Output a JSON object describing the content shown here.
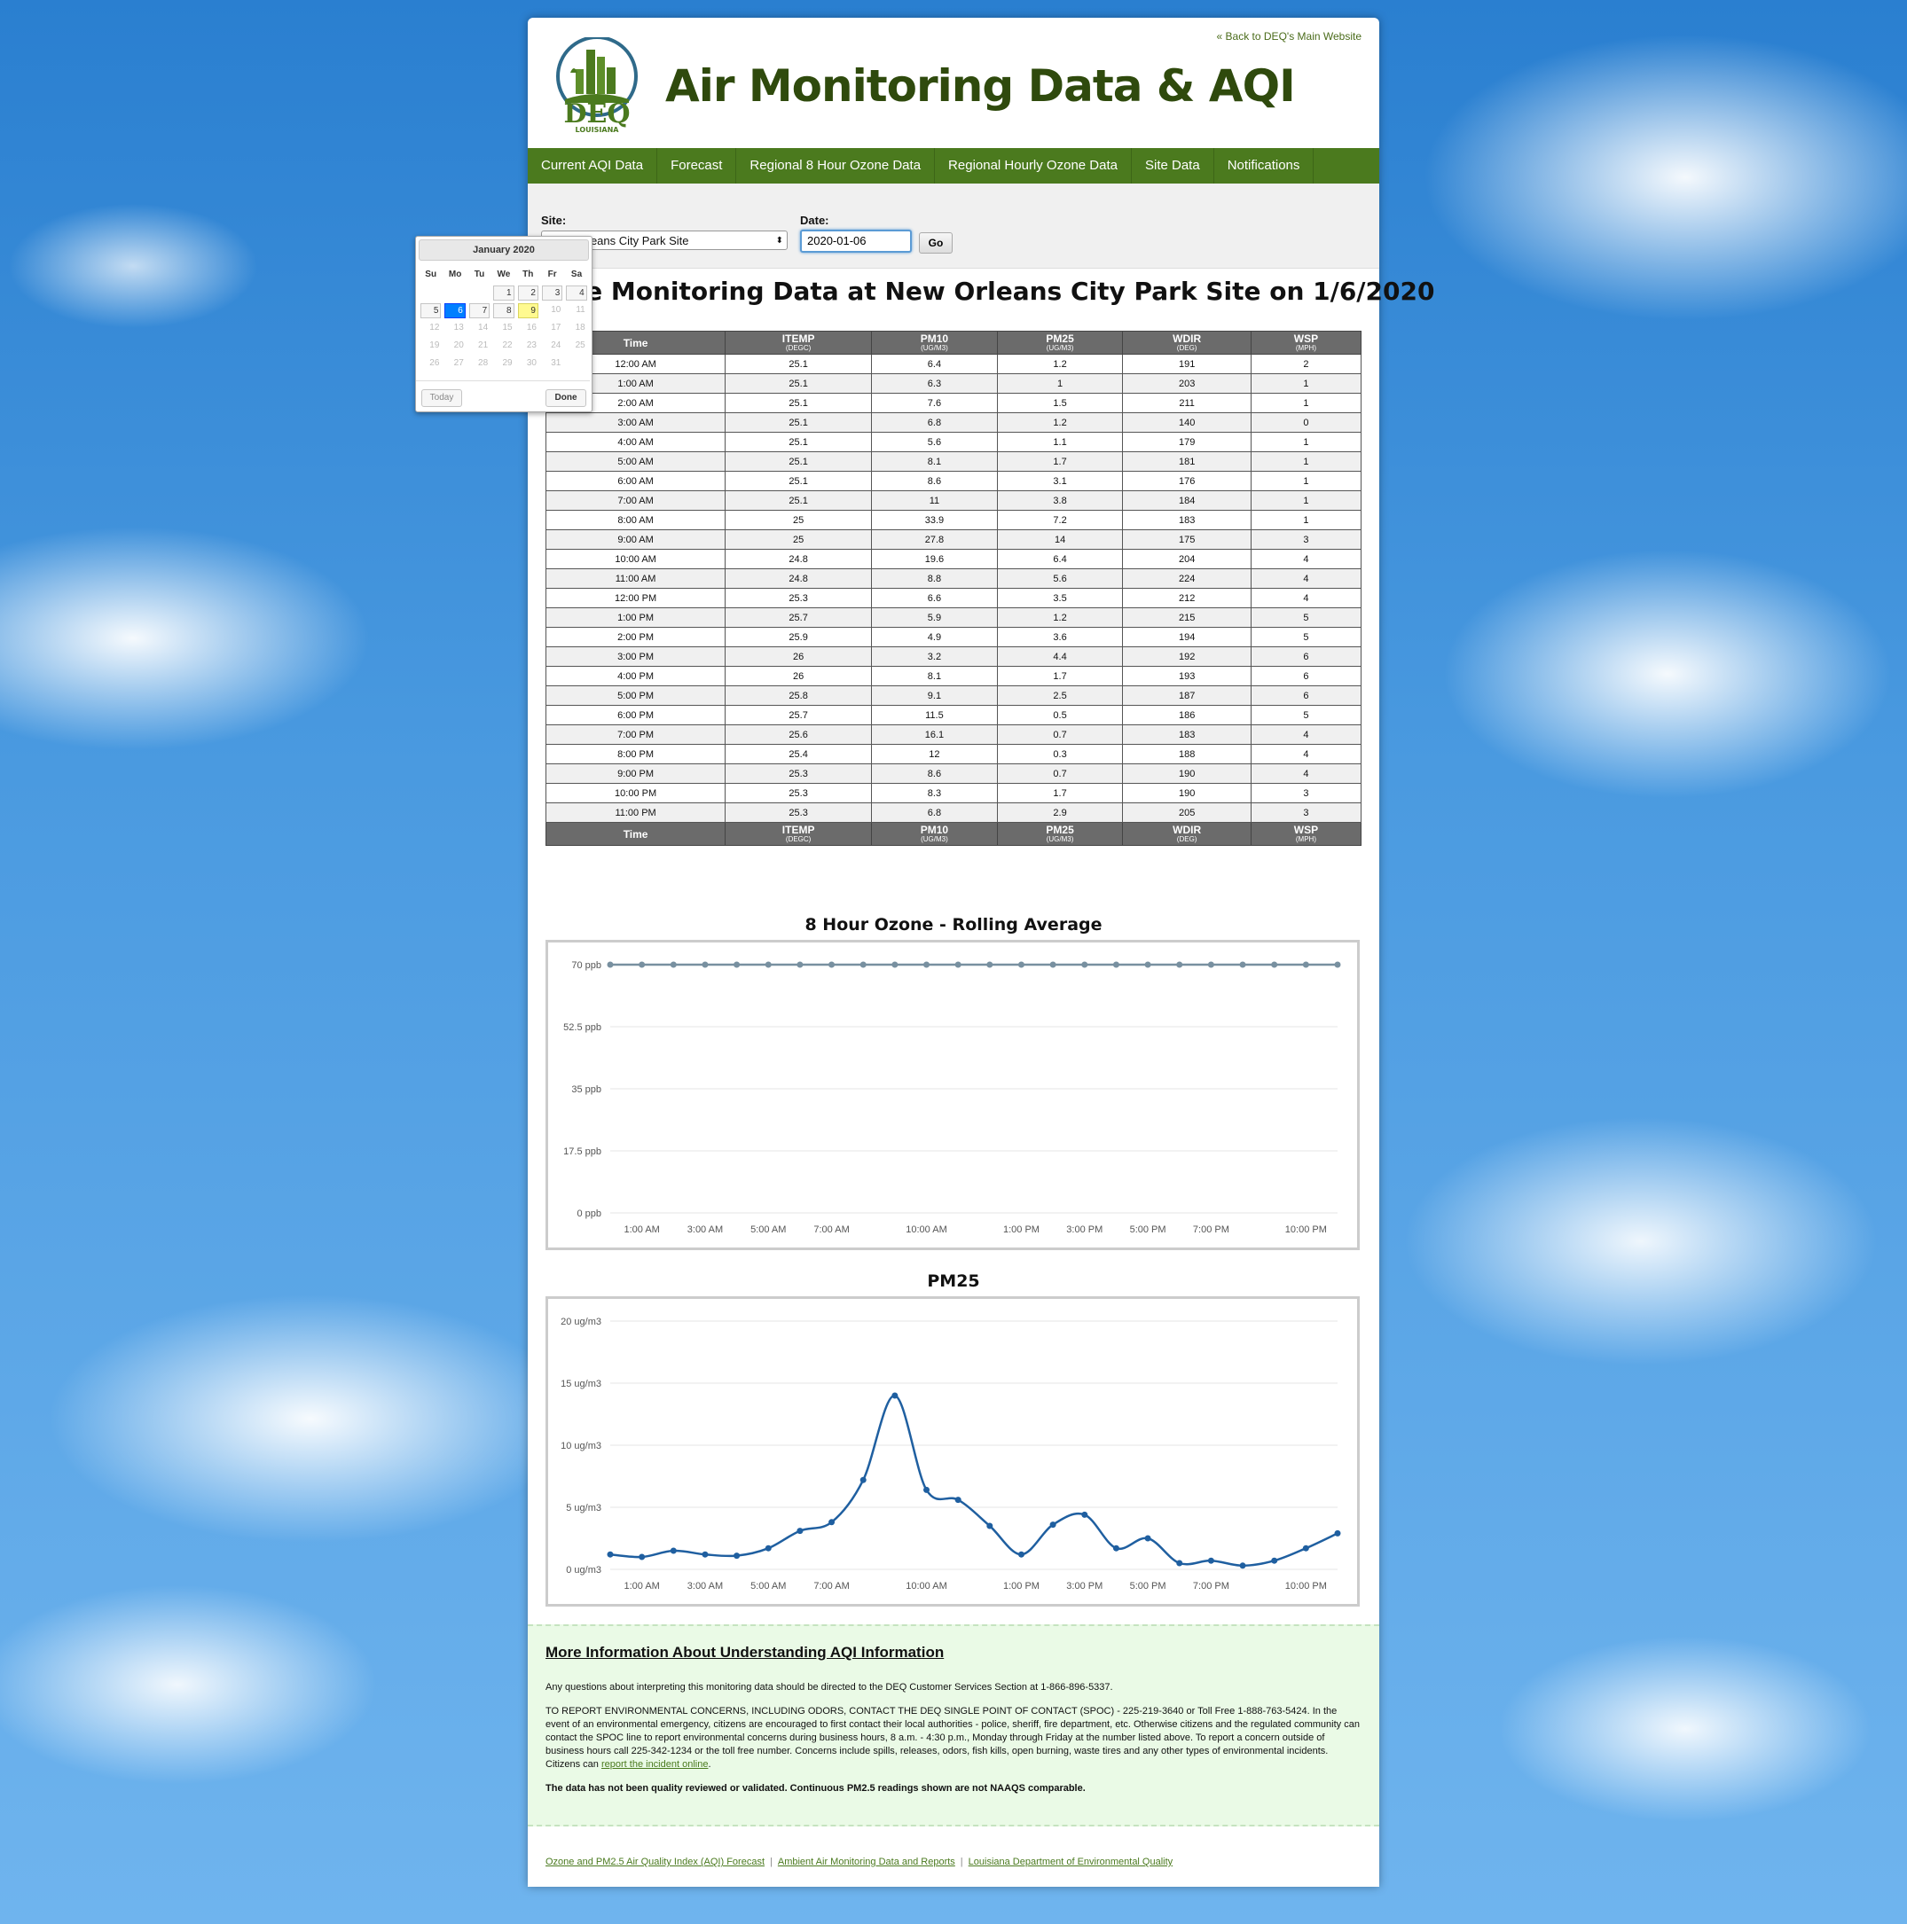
{
  "header": {
    "back_link": "« Back to DEQ's Main Website",
    "logo_text": "DEQ",
    "logo_sub": "LOUISIANA",
    "title": "Air Monitoring Data & AQI"
  },
  "nav": [
    "Current AQI Data",
    "Forecast",
    "Regional 8 Hour Ozone Data",
    "Regional Hourly Ozone Data",
    "Site Data",
    "Notifications"
  ],
  "controls": {
    "site_label": "Site:",
    "site_value": "New Orleans City Park Site",
    "date_label": "Date:",
    "date_value": "2020-01-06",
    "go_label": "Go"
  },
  "page_title": "Site Monitoring Data at New Orleans City Park Site on 1/6/2020",
  "table": {
    "columns": [
      {
        "name": "Time",
        "unit": ""
      },
      {
        "name": "ITEMP",
        "unit": "(DEGC)"
      },
      {
        "name": "PM10",
        "unit": "(UG/M3)"
      },
      {
        "name": "PM25",
        "unit": "(UG/M3)"
      },
      {
        "name": "WDIR",
        "unit": "(DEG)"
      },
      {
        "name": "WSP",
        "unit": "(MPH)"
      }
    ],
    "rows": [
      [
        "12:00 AM",
        "25.1",
        "6.4",
        "1.2",
        "191",
        "2"
      ],
      [
        "1:00 AM",
        "25.1",
        "6.3",
        "1",
        "203",
        "1"
      ],
      [
        "2:00 AM",
        "25.1",
        "7.6",
        "1.5",
        "211",
        "1"
      ],
      [
        "3:00 AM",
        "25.1",
        "6.8",
        "1.2",
        "140",
        "0"
      ],
      [
        "4:00 AM",
        "25.1",
        "5.6",
        "1.1",
        "179",
        "1"
      ],
      [
        "5:00 AM",
        "25.1",
        "8.1",
        "1.7",
        "181",
        "1"
      ],
      [
        "6:00 AM",
        "25.1",
        "8.6",
        "3.1",
        "176",
        "1"
      ],
      [
        "7:00 AM",
        "25.1",
        "11",
        "3.8",
        "184",
        "1"
      ],
      [
        "8:00 AM",
        "25",
        "33.9",
        "7.2",
        "183",
        "1"
      ],
      [
        "9:00 AM",
        "25",
        "27.8",
        "14",
        "175",
        "3"
      ],
      [
        "10:00 AM",
        "24.8",
        "19.6",
        "6.4",
        "204",
        "4"
      ],
      [
        "11:00 AM",
        "24.8",
        "8.8",
        "5.6",
        "224",
        "4"
      ],
      [
        "12:00 PM",
        "25.3",
        "6.6",
        "3.5",
        "212",
        "4"
      ],
      [
        "1:00 PM",
        "25.7",
        "5.9",
        "1.2",
        "215",
        "5"
      ],
      [
        "2:00 PM",
        "25.9",
        "4.9",
        "3.6",
        "194",
        "5"
      ],
      [
        "3:00 PM",
        "26",
        "3.2",
        "4.4",
        "192",
        "6"
      ],
      [
        "4:00 PM",
        "26",
        "8.1",
        "1.7",
        "193",
        "6"
      ],
      [
        "5:00 PM",
        "25.8",
        "9.1",
        "2.5",
        "187",
        "6"
      ],
      [
        "6:00 PM",
        "25.7",
        "11.5",
        "0.5",
        "186",
        "5"
      ],
      [
        "7:00 PM",
        "25.6",
        "16.1",
        "0.7",
        "183",
        "4"
      ],
      [
        "8:00 PM",
        "25.4",
        "12",
        "0.3",
        "188",
        "4"
      ],
      [
        "9:00 PM",
        "25.3",
        "8.6",
        "0.7",
        "190",
        "4"
      ],
      [
        "10:00 PM",
        "25.3",
        "8.3",
        "1.7",
        "190",
        "3"
      ],
      [
        "11:00 PM",
        "25.3",
        "6.8",
        "2.9",
        "205",
        "3"
      ]
    ]
  },
  "chart_data": [
    {
      "type": "line",
      "title": "8 Hour Ozone - Rolling Average",
      "x": [
        "12:00 AM",
        "1:00 AM",
        "2:00 AM",
        "3:00 AM",
        "4:00 AM",
        "5:00 AM",
        "6:00 AM",
        "7:00 AM",
        "8:00 AM",
        "9:00 AM",
        "10:00 AM",
        "11:00 AM",
        "12:00 PM",
        "1:00 PM",
        "2:00 PM",
        "3:00 PM",
        "4:00 PM",
        "5:00 PM",
        "6:00 PM",
        "7:00 PM",
        "8:00 PM",
        "9:00 PM",
        "10:00 PM",
        "11:00 PM"
      ],
      "x_tick_labels": [
        "1:00 AM",
        "3:00 AM",
        "5:00 AM",
        "7:00 AM",
        "10:00 AM",
        "1:00 PM",
        "3:00 PM",
        "5:00 PM",
        "7:00 PM",
        "10:00 PM"
      ],
      "series": [
        {
          "values": [
            70,
            70,
            70,
            70,
            70,
            70,
            70,
            70,
            70,
            70,
            70,
            70,
            70,
            70,
            70,
            70,
            70,
            70,
            70,
            70,
            70,
            70,
            70,
            70
          ]
        }
      ],
      "y_ticks": [
        "0 ppb",
        "17.5 ppb",
        "35 ppb",
        "52.5 ppb",
        "70 ppb"
      ],
      "ylim": [
        0,
        70
      ],
      "color": "#7890a0",
      "grid": true
    },
    {
      "type": "line",
      "title": "PM25",
      "x": [
        "12:00 AM",
        "1:00 AM",
        "2:00 AM",
        "3:00 AM",
        "4:00 AM",
        "5:00 AM",
        "6:00 AM",
        "7:00 AM",
        "8:00 AM",
        "9:00 AM",
        "10:00 AM",
        "11:00 AM",
        "12:00 PM",
        "1:00 PM",
        "2:00 PM",
        "3:00 PM",
        "4:00 PM",
        "5:00 PM",
        "6:00 PM",
        "7:00 PM",
        "8:00 PM",
        "9:00 PM",
        "10:00 PM",
        "11:00 PM"
      ],
      "x_tick_labels": [
        "1:00 AM",
        "3:00 AM",
        "5:00 AM",
        "7:00 AM",
        "10:00 AM",
        "1:00 PM",
        "3:00 PM",
        "5:00 PM",
        "7:00 PM",
        "10:00 PM"
      ],
      "series": [
        {
          "values": [
            1.2,
            1,
            1.5,
            1.2,
            1.1,
            1.7,
            3.1,
            3.8,
            7.2,
            14,
            6.4,
            5.6,
            3.5,
            1.2,
            3.6,
            4.4,
            1.7,
            2.5,
            0.5,
            0.7,
            0.3,
            0.7,
            1.7,
            2.9
          ]
        }
      ],
      "y_ticks": [
        "0 ug/m3",
        "5 ug/m3",
        "10 ug/m3",
        "15 ug/m3",
        "20 ug/m3"
      ],
      "ylim": [
        0,
        20
      ],
      "color": "#1f5fa0",
      "grid": true
    }
  ],
  "info": {
    "heading": "More Information About Understanding AQI Information",
    "p1": "Any questions about interpreting this monitoring data should be directed to the DEQ Customer Services Section at 1-866-896-5337.",
    "p2": "TO REPORT ENVIRONMENTAL CONCERNS, INCLUDING ODORS, CONTACT THE DEQ SINGLE POINT OF CONTACT (SPOC) - 225-219-3640 or Toll Free 1-888-763-5424. In the event of an environmental emergency, citizens are encouraged to first contact their local authorities - police, sheriff, fire department, etc. Otherwise citizens and the regulated community can contact the SPOC line to report environmental concerns during business hours, 8 a.m. - 4:30 p.m., Monday through Friday at the number listed above. To report a concern outside of business hours call 225-342-1234 or the toll free number. Concerns include spills, releases, odors, fish kills, open burning, waste tires and any other types of environmental incidents. Citizens can",
    "p2_link": "report the incident online",
    "p2_end": ".",
    "p3": "The data has not been quality reviewed or validated. Continuous PM2.5 readings shown are not NAAQS comparable."
  },
  "footer": {
    "links": [
      "Ozone and PM2.5 Air Quality Index (AQI) Forecast",
      "Ambient Air Monitoring Data and Reports",
      "Louisiana Department of Environmental Quality"
    ],
    "separator": "|"
  },
  "datepicker": {
    "month": "January 2020",
    "dow": [
      "Su",
      "Mo",
      "Tu",
      "We",
      "Th",
      "Fr",
      "Sa"
    ],
    "weeks": [
      [
        "",
        "",
        "",
        "1",
        "2",
        "3",
        "4"
      ],
      [
        "5",
        "6",
        "7",
        "8",
        "9",
        "10",
        "11"
      ],
      [
        "12",
        "13",
        "14",
        "15",
        "16",
        "17",
        "18"
      ],
      [
        "19",
        "20",
        "21",
        "22",
        "23",
        "24",
        "25"
      ],
      [
        "26",
        "27",
        "28",
        "29",
        "30",
        "31",
        ""
      ]
    ],
    "selected": "6",
    "today": "9",
    "today_label": "Today",
    "done_label": "Done"
  }
}
